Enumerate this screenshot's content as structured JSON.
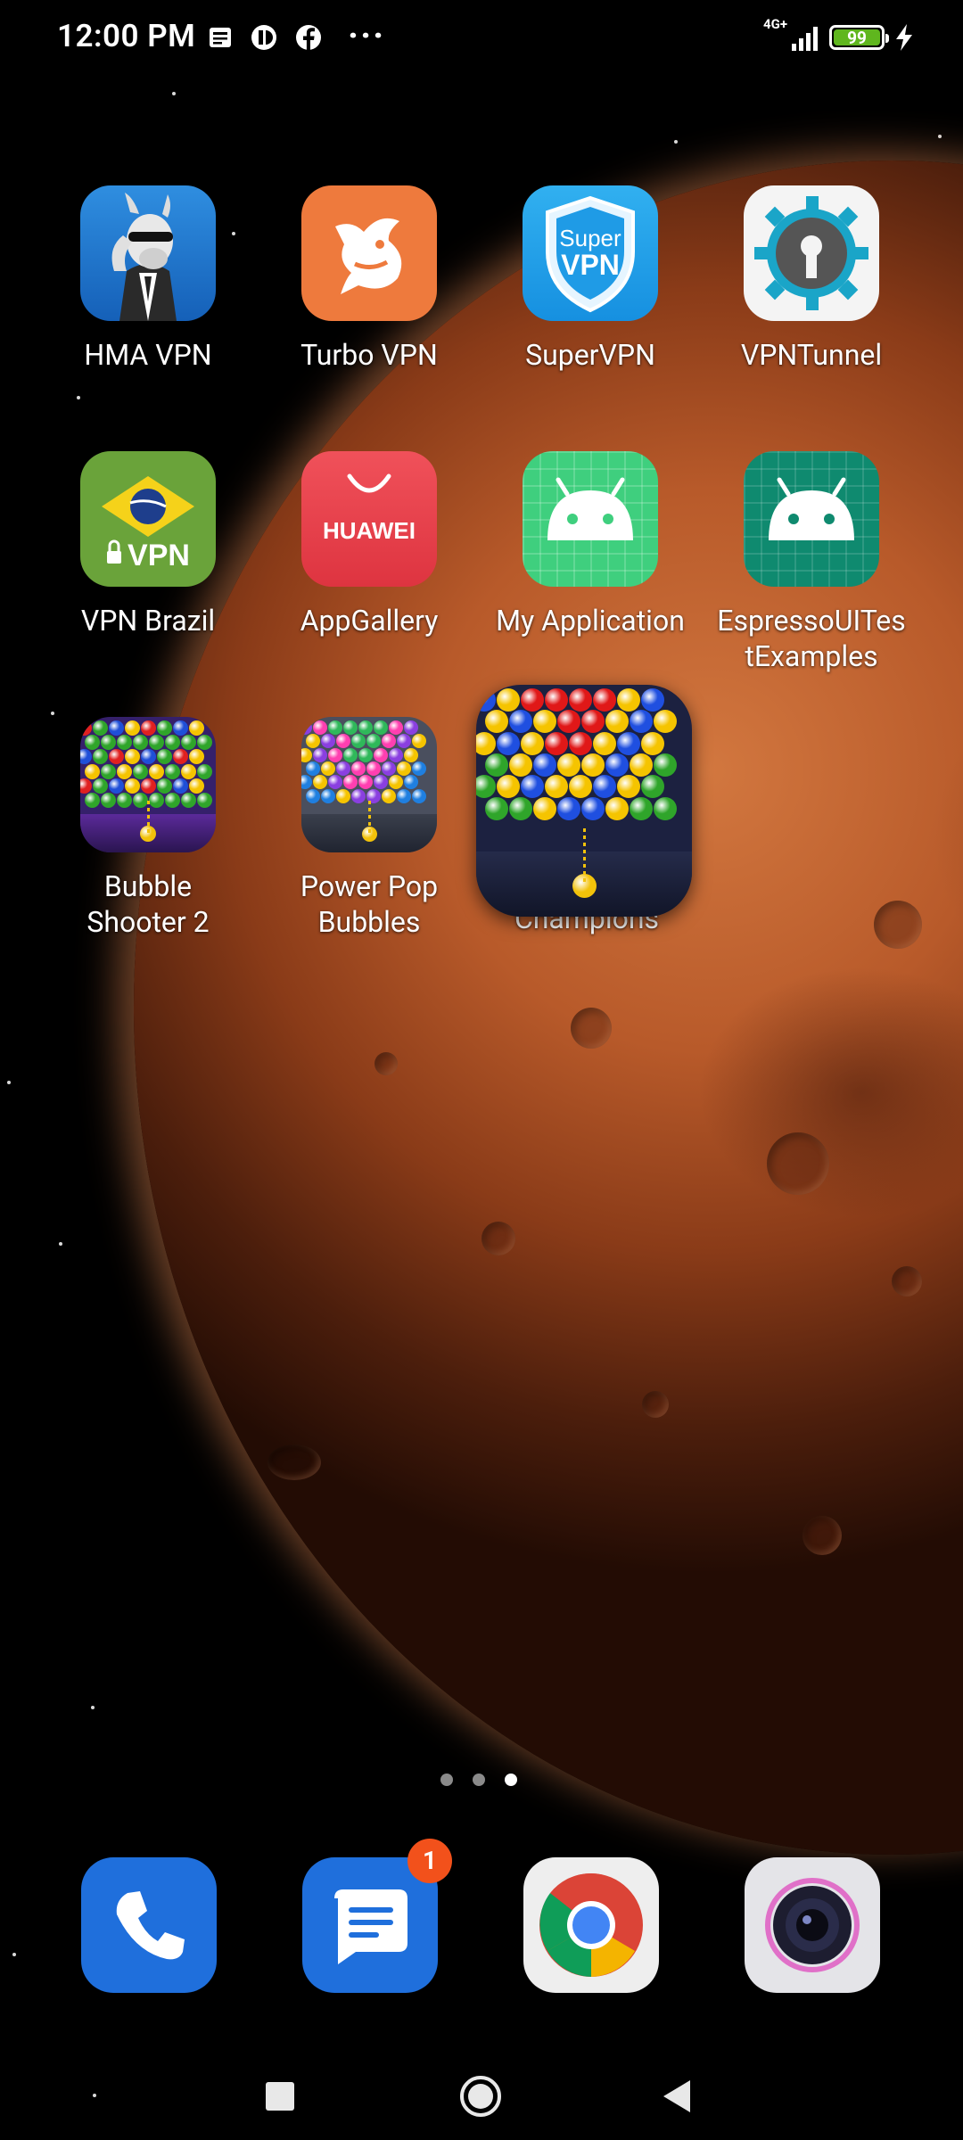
{
  "status_bar": {
    "time": "12:00 PM",
    "notification_icons": [
      "news-icon",
      "app-icon",
      "facebook-icon",
      "more-icon"
    ],
    "network": "4G+",
    "battery_level": "99",
    "charging": true
  },
  "apps": [
    {
      "label": "HMA VPN",
      "icon": "hma-vpn-icon"
    },
    {
      "label": "Turbo VPN",
      "icon": "turbo-vpn-icon"
    },
    {
      "label": "SuperVPN",
      "icon": "supervpn-icon"
    },
    {
      "label": "VPNTunnel",
      "icon": "vpntunnel-icon"
    },
    {
      "label": "VPN Brazil",
      "icon": "vpn-brazil-icon"
    },
    {
      "label": "AppGallery",
      "icon": "appgallery-icon"
    },
    {
      "label": "My Application",
      "icon": "android-icon"
    },
    {
      "label": "EspressoUITestExamples",
      "label_lines": [
        "EspressoUITes",
        "tExamples"
      ],
      "icon": "android-icon"
    },
    {
      "label": "Bubble Shooter 2",
      "label_lines": [
        "Bubble",
        "Shooter 2"
      ],
      "icon": "bubble-shooter-icon"
    },
    {
      "label": "Power Pop Bubbles",
      "label_lines": [
        "Power Pop",
        "Bubbles"
      ],
      "icon": "power-pop-icon"
    },
    {
      "label": "Champions",
      "icon": "bubble-champions-icon",
      "state": "being-dragged"
    }
  ],
  "icon_text": {
    "super_top": "Super",
    "super_bottom": "VPN",
    "brazil": "VPN",
    "huawei": "HUAWEI"
  },
  "page_indicator": {
    "pages": 3,
    "current": 3
  },
  "dock": [
    {
      "name": "Phone",
      "icon": "phone-icon"
    },
    {
      "name": "Messages",
      "icon": "messages-icon",
      "badge": "1"
    },
    {
      "name": "Chrome",
      "icon": "chrome-icon"
    },
    {
      "name": "Camera",
      "icon": "camera-icon"
    }
  ],
  "nav_bar": [
    "recents-button",
    "home-button",
    "back-button"
  ]
}
